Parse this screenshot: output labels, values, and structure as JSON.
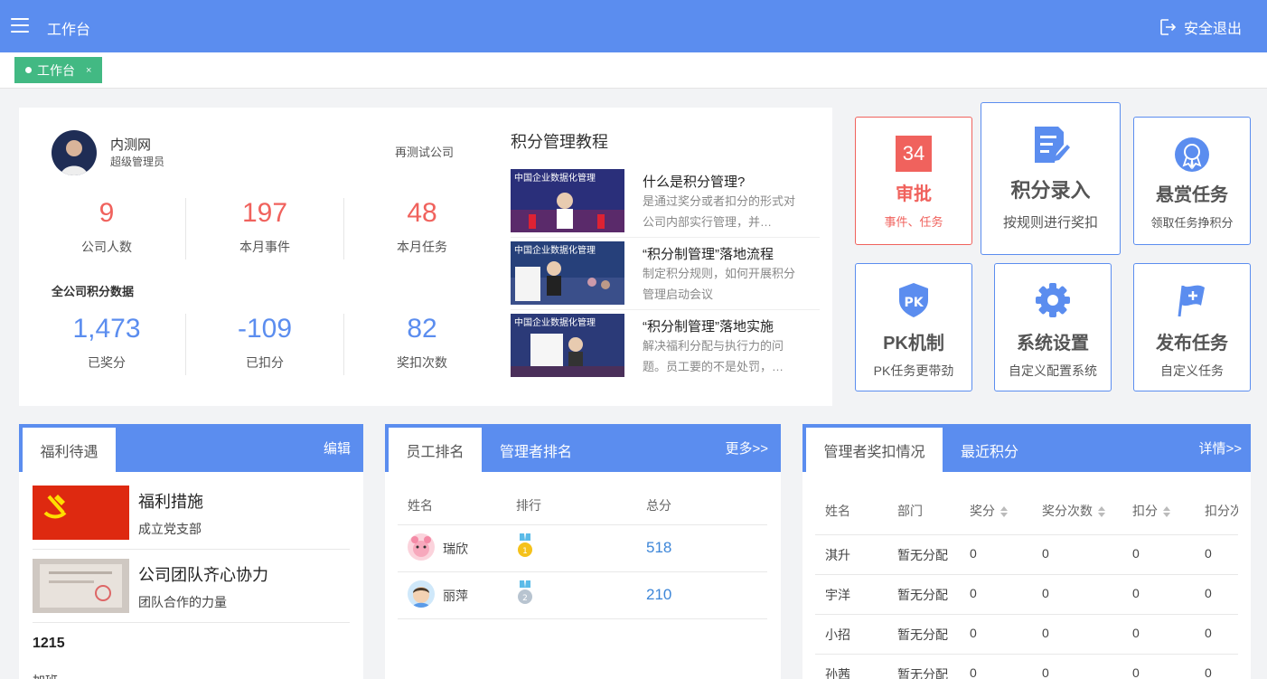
{
  "header": {
    "title": "工作台",
    "logout_label": "安全退出"
  },
  "tabs": [
    {
      "label": "工作台",
      "close": "×"
    }
  ],
  "profile": {
    "name": "内测网",
    "role": "超级管理员",
    "company": "再测试公司",
    "stats": [
      {
        "value": "9",
        "label": "公司人数"
      },
      {
        "value": "197",
        "label": "本月事件"
      },
      {
        "value": "48",
        "label": "本月任务"
      }
    ],
    "points_section_title": "全公司积分数据",
    "points": [
      {
        "value": "1,473",
        "label": "已奖分"
      },
      {
        "value": "-109",
        "label": "已扣分"
      },
      {
        "value": "82",
        "label": "奖扣次数"
      }
    ]
  },
  "tutorials": {
    "title": "积分管理教程",
    "thumb_caption": "中国企业数据化管理",
    "items": [
      {
        "title": "什么是积分管理?",
        "desc": "是通过奖分或者扣分的形式对公司内部实行管理，并…"
      },
      {
        "title": "“积分制管理”落地流程",
        "desc": "制定积分规则，如何开展积分管理启动会议"
      },
      {
        "title": "“积分制管理”落地实施",
        "desc": "解决福利分配与执行力的问题。员工要的不是处罚，…"
      }
    ]
  },
  "tiles": {
    "approve": {
      "badge": "34",
      "title": "审批",
      "sub": "事件、任务",
      "color": "#f0625d"
    },
    "entry": {
      "title": "积分录入",
      "sub": "按规则进行奖扣"
    },
    "reward": {
      "title": "悬赏任务",
      "sub": "领取任务挣积分"
    },
    "pk": {
      "title": "PK机制",
      "sub": "PK任务更带劲",
      "icon_text": "PK"
    },
    "settings": {
      "title": "系统设置",
      "sub": "自定义配置系统"
    },
    "publish": {
      "title": "发布任务",
      "sub": "自定义任务"
    }
  },
  "welfare": {
    "tab": "福利待遇",
    "edit": "编辑",
    "items": [
      {
        "title": "福利措施",
        "desc": "成立党支部"
      },
      {
        "title": "公司团队齐心协力",
        "desc": "团队合作的力量"
      }
    ],
    "extra_title": "1215",
    "extra_desc": "加班"
  },
  "ranking": {
    "tab_active": "员工排名",
    "tab_other": "管理者排名",
    "more": "更多>>",
    "columns": [
      "姓名",
      "排行",
      "总分"
    ],
    "rows": [
      {
        "name": "瑞欣",
        "rank": "1",
        "score": "518"
      },
      {
        "name": "丽萍",
        "rank": "2",
        "score": "210"
      }
    ]
  },
  "manager": {
    "tab_active": "管理者奖扣情况",
    "tab_other": "最近积分",
    "detail": "详情>>",
    "columns": [
      "姓名",
      "部门",
      "奖分",
      "奖分次数",
      "扣分",
      "扣分次数"
    ],
    "rows": [
      {
        "name": "淇升",
        "dept": "暂无分配",
        "award": "0",
        "award_times": "0",
        "deduct": "0",
        "deduct_times": "0"
      },
      {
        "name": "宇洋",
        "dept": "暂无分配",
        "award": "0",
        "award_times": "0",
        "deduct": "0",
        "deduct_times": "0"
      },
      {
        "name": "小招",
        "dept": "暂无分配",
        "award": "0",
        "award_times": "0",
        "deduct": "0",
        "deduct_times": "0"
      },
      {
        "name": "孙茜",
        "dept": "暂无分配",
        "award": "0",
        "award_times": "0",
        "deduct": "0",
        "deduct_times": "0"
      }
    ]
  },
  "colors": {
    "primary": "#5b8def",
    "accent_red": "#f0625d",
    "tab_green": "#42b983"
  }
}
